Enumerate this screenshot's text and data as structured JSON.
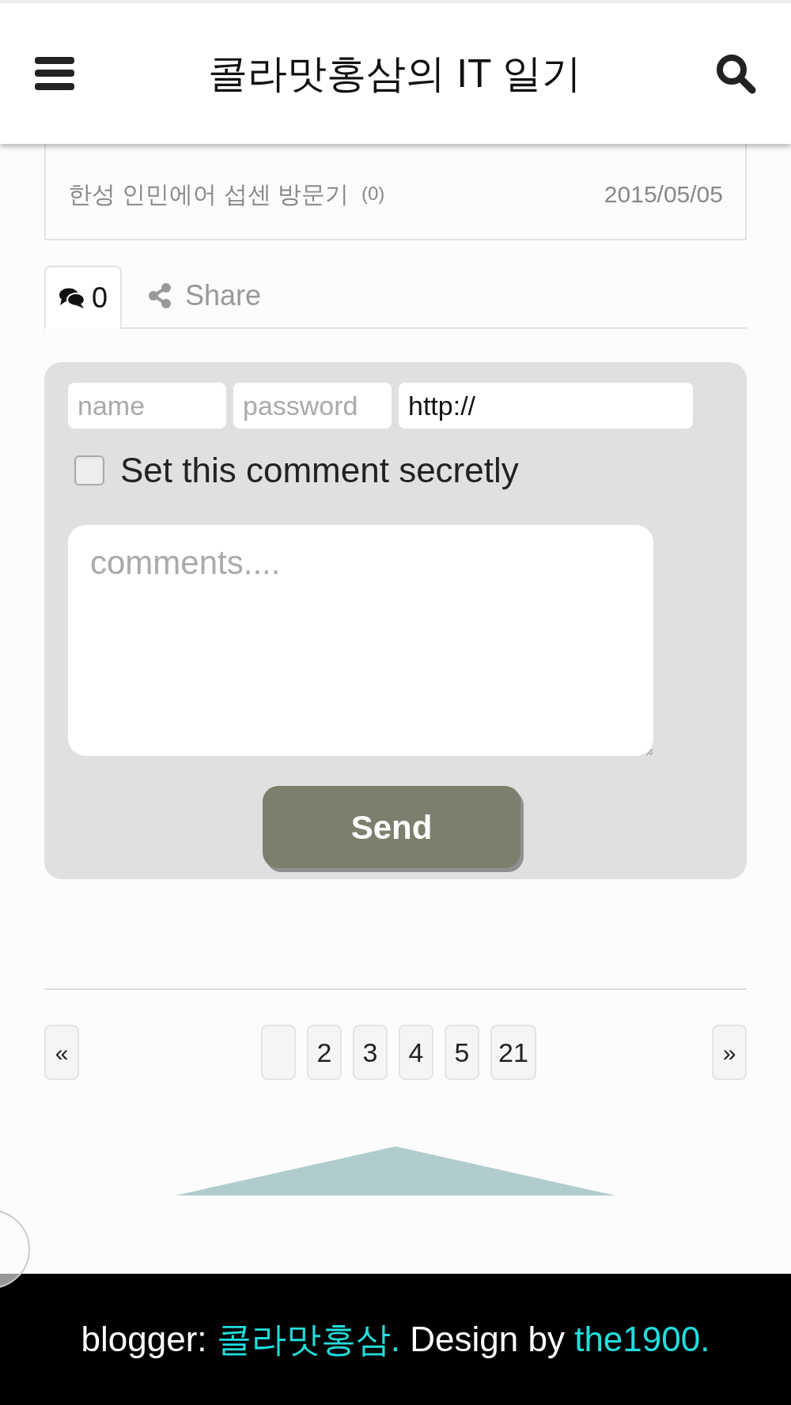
{
  "header": {
    "title": "콜라맛홍삼의 IT 일기"
  },
  "related_posts": [
    {
      "title": "한성 인민에어 섭센 방문기",
      "comments": "(0)",
      "date": "2015/05/05"
    }
  ],
  "tabs": [
    {
      "kind": "comments",
      "label": "0",
      "selected": true
    },
    {
      "kind": "share",
      "label": "Share",
      "selected": false
    }
  ],
  "comment_form": {
    "name": {
      "placeholder": "name"
    },
    "password": {
      "placeholder": "password"
    },
    "homepage": {
      "value": "http://"
    },
    "secret": {
      "label": "Set this comment secretly",
      "checked": false
    },
    "comment": {
      "placeholder": "comments...."
    },
    "submit": "Send"
  },
  "pagination": {
    "prev": "«",
    "next": "»",
    "pages": [
      {
        "kind": "empty"
      },
      {
        "kind": "number",
        "label": "2"
      },
      {
        "kind": "number",
        "label": "3"
      },
      {
        "kind": "number",
        "label": "4"
      },
      {
        "kind": "number",
        "label": "5"
      },
      {
        "kind": "number",
        "label": "21"
      }
    ]
  },
  "footer": {
    "prefix": "blogger:",
    "blogger": "콜라맛홍삼.",
    "middle": "Design by",
    "designer": "the1900."
  }
}
